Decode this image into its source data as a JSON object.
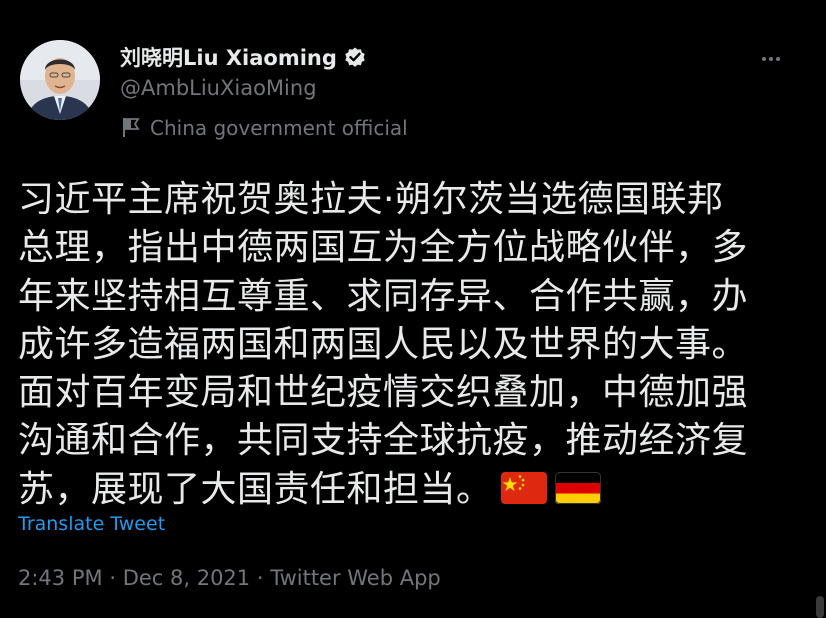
{
  "user": {
    "display_name": "刘晓明Liu Xiaoming",
    "handle": "@AmbLiuXiaoMing",
    "label": "China government official",
    "verified": true
  },
  "tweet": {
    "lines": [
      "习近平主席祝贺奥拉夫·朔尔茨当选德国联邦",
      "总理，指出中德两国互为全方位战略伙伴，多",
      "年来坚持相互尊重、求同存异、合作共赢，办",
      "成许多造福两国和两国人民以及世界的大事。",
      "面对百年变局和世纪疫情交织叠加，中德加强",
      "沟通和合作，共同支持全球抗疫，推动经济复",
      "苏，展现了大国责任和担当。"
    ],
    "flags": [
      "china-flag",
      "germany-flag"
    ],
    "translate_label": "Translate Tweet"
  },
  "meta": {
    "time": "2:43 PM",
    "separator": "·",
    "date": "Dec 8, 2021",
    "source": "Twitter Web App"
  },
  "colors": {
    "background": "#000000",
    "text": "#e7e9ea",
    "secondary": "#71767b",
    "link": "#1d9bf0"
  }
}
